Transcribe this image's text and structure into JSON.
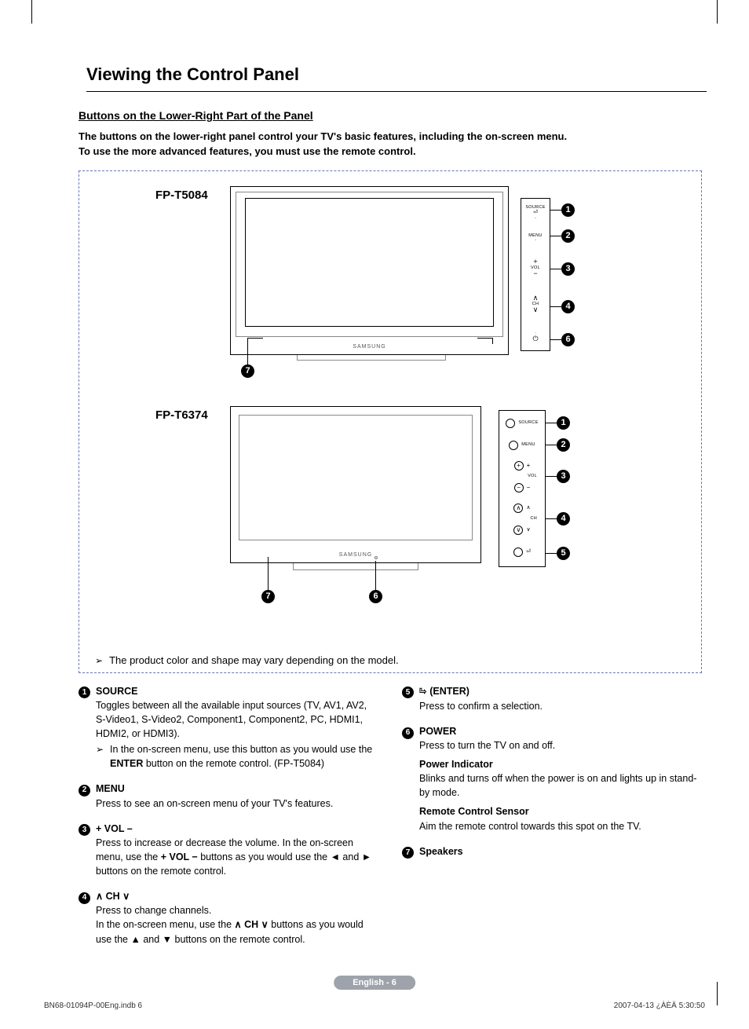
{
  "title": "Viewing the Control Panel",
  "subheading": "Buttons on the Lower-Right Part of the Panel",
  "intro_line1": "The buttons on the lower-right panel control your TV's basic features, including the on-screen menu.",
  "intro_line2": "To use the more advanced features, you must use the remote control.",
  "models": {
    "m1": "FP-T5084",
    "m2": "FP-T6374"
  },
  "diagram_note": "The product color and shape may vary depending on the model.",
  "panel1_labels": {
    "source": "SOURCE",
    "enter": "⏎",
    "menu": "MENU",
    "vol": "VOL",
    "ch": "CH"
  },
  "panel2_labels": {
    "source": "SOURCE",
    "menu": "MENU",
    "vol": "VOL",
    "ch": "CH"
  },
  "callouts": {
    "c1": "1",
    "c2": "2",
    "c3": "3",
    "c4": "4",
    "c5": "5",
    "c6": "6",
    "c7": "7"
  },
  "desc": {
    "i1": {
      "title": "SOURCE",
      "body": "Toggles between all the available input sources (TV, AV1, AV2, S-Video1, S-Video2, Component1, Component2, PC, HDMI1, HDMI2, or HDMI3).",
      "sub_a": "In the on-screen menu, use this button as you would use the ",
      "sub_b": "ENTER",
      "sub_c": " button on the remote control. (FP-T5084)"
    },
    "i2": {
      "title": "MENU",
      "body": "Press to see an on-screen menu of your TV's features."
    },
    "i3": {
      "title": "+ VOL –",
      "body_a": "Press to increase or decrease the volume. In the on-screen menu, use the ",
      "body_b": "+ VOL −",
      "body_c": " buttons as you would use the ◄ and ► buttons on the remote control."
    },
    "i4": {
      "title_a": " CH ",
      "body_a": "Press to change channels.",
      "body_b": "In the on-screen menu, use the ",
      "body_c": " CH ",
      "body_d": " buttons as you would use the ▲ and ▼ buttons on the remote control."
    },
    "i5": {
      "title": "(ENTER)",
      "body": "Press to confirm a selection."
    },
    "i6": {
      "title": "POWER",
      "body": "Press to turn the TV on and off.",
      "h2": "Power Indicator",
      "body2": "Blinks and turns off when the power is on and lights up in stand-by mode.",
      "h3": "Remote Control Sensor",
      "body3": "Aim the remote control towards this spot on the TV."
    },
    "i7": {
      "title": "Speakers"
    }
  },
  "footer": {
    "page": "English - 6",
    "left": "BN68-01094P-00Eng.indb   6",
    "right": "2007-04-13   ¿ÀÈÄ 5:30:50"
  }
}
